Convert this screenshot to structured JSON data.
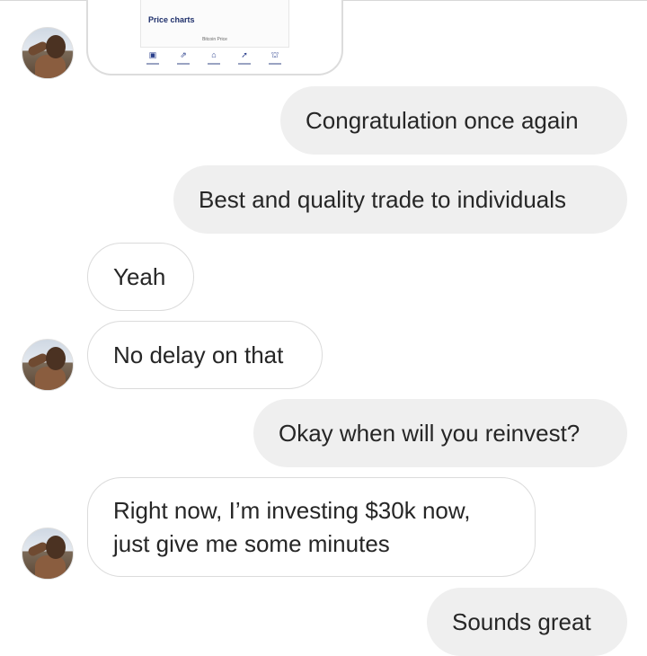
{
  "shared_screenshot": {
    "section_title": "Price charts",
    "chart_subtitle": "Bitcoin Price",
    "nav_icons": [
      "page-icon",
      "chart-icon",
      "home-icon",
      "send-icon",
      "bank-icon"
    ]
  },
  "messages": [
    {
      "direction": "outgoing",
      "text": "Congratulation once again"
    },
    {
      "direction": "outgoing",
      "text": "Best and quality trade to individuals"
    },
    {
      "direction": "incoming",
      "text": "Yeah"
    },
    {
      "direction": "incoming",
      "text": "No delay on that"
    },
    {
      "direction": "outgoing",
      "text": "Okay when will you reinvest?"
    },
    {
      "direction": "incoming",
      "text": "Right now, I’m investing $30k now, just give me some minutes"
    },
    {
      "direction": "outgoing",
      "text": "Sounds great"
    }
  ],
  "colors": {
    "outgoing_bubble": "#efefef",
    "incoming_border": "#dbdbdb",
    "text": "#262626"
  }
}
